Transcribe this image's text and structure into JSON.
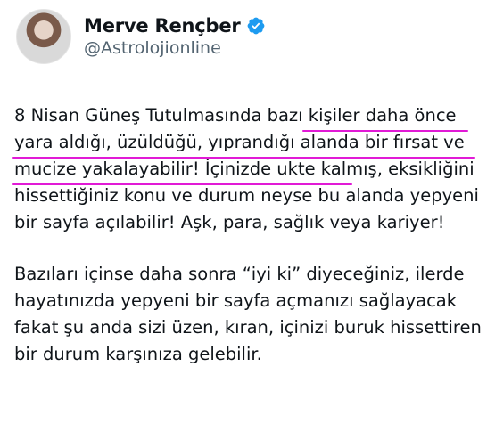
{
  "author": {
    "display_name": "Merve Rençber",
    "handle": "@Astrolojionline",
    "verified": true,
    "verified_color": "#1d9bf0"
  },
  "tweet": {
    "paragraph_1": "8 Nisan Güneş Tutulmasında bazı kişiler daha önce yara aldığı, üzüldüğü, yıprandığı alanda bir fırsat ve mucize yakalayabilir! İçinizde ukte kalmış, eksikliğini hissettiğiniz konu ve durum neyse bu alanda yepyeni bir sayfa açılabilir! Aşk, para, sağlık veya kariyer!",
    "paragraph_2": "Bazıları içinse daha sonra “iyi ki” diyeceğiniz, ilerde hayatınızda yepyeni bir sayfa açmanızı sağlayacak fakat şu anda sizi üzen, kıran, içinizi buruk hissettiren bir durum karşınıza gelebilir."
  },
  "annotation_color": "#e11ad6"
}
